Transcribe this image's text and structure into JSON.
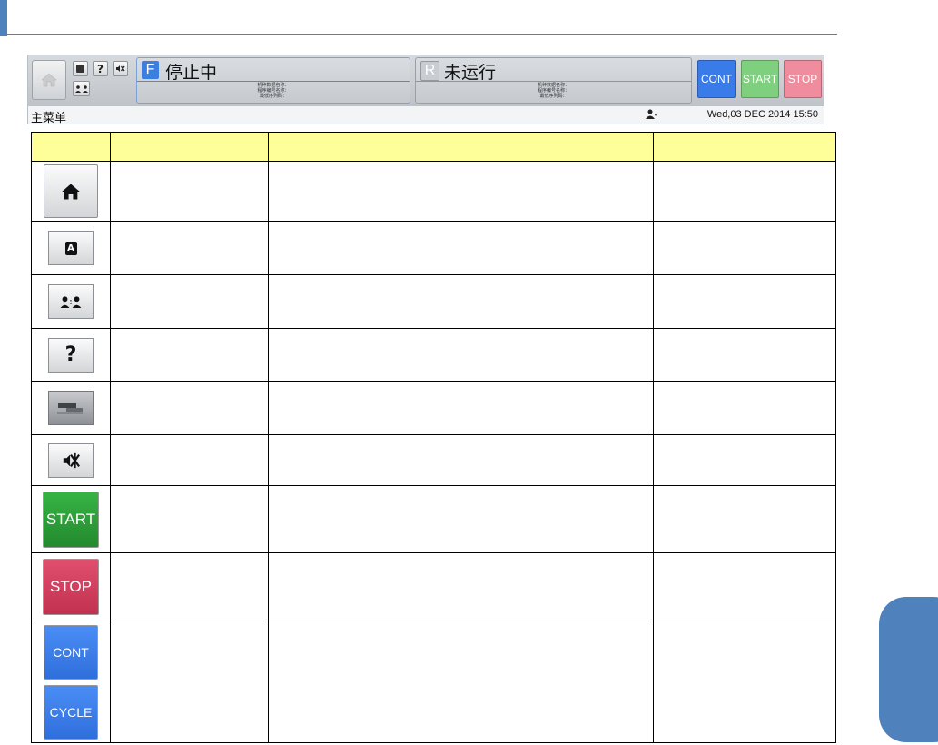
{
  "hmi": {
    "screen_title": "主菜单",
    "datetime": "Wed,03 DEC 2014   15:50",
    "front": {
      "badge": "F",
      "status": "停止中",
      "info": [
        "机种数据名称：",
        "程序编号名称：",
        "最低序列码："
      ]
    },
    "rear": {
      "badge": "R",
      "status": "未运行",
      "info": [
        "机种数据名称：",
        "程序编号名称：",
        "最低序列码："
      ]
    },
    "help_label": "?",
    "buttons": {
      "cont": "CONT",
      "start": "START",
      "stop": "STOP"
    }
  },
  "table": {
    "headers": [
      "",
      "",
      "",
      ""
    ],
    "rows": [
      {
        "icon": "home-icon",
        "label": ""
      },
      {
        "icon": "font-a-icon",
        "label": "A"
      },
      {
        "icon": "user-switch-icon",
        "label": ""
      },
      {
        "icon": "help-icon",
        "label": "?"
      },
      {
        "icon": "blurred-icon",
        "label": ""
      },
      {
        "icon": "mute-icon",
        "label": ""
      },
      {
        "icon": "start-button",
        "label": "START"
      },
      {
        "icon": "stop-button",
        "label": "STOP"
      },
      {
        "icon": "cont-cycle-buttons",
        "labels": [
          "CONT",
          "CYCLE"
        ]
      }
    ]
  },
  "colors": {
    "accent": "#4f81bd",
    "header_fill": "#ffff99",
    "start_green": "#2ea03b",
    "stop_red": "#d23c5c",
    "cont_blue": "#3a7bea"
  }
}
